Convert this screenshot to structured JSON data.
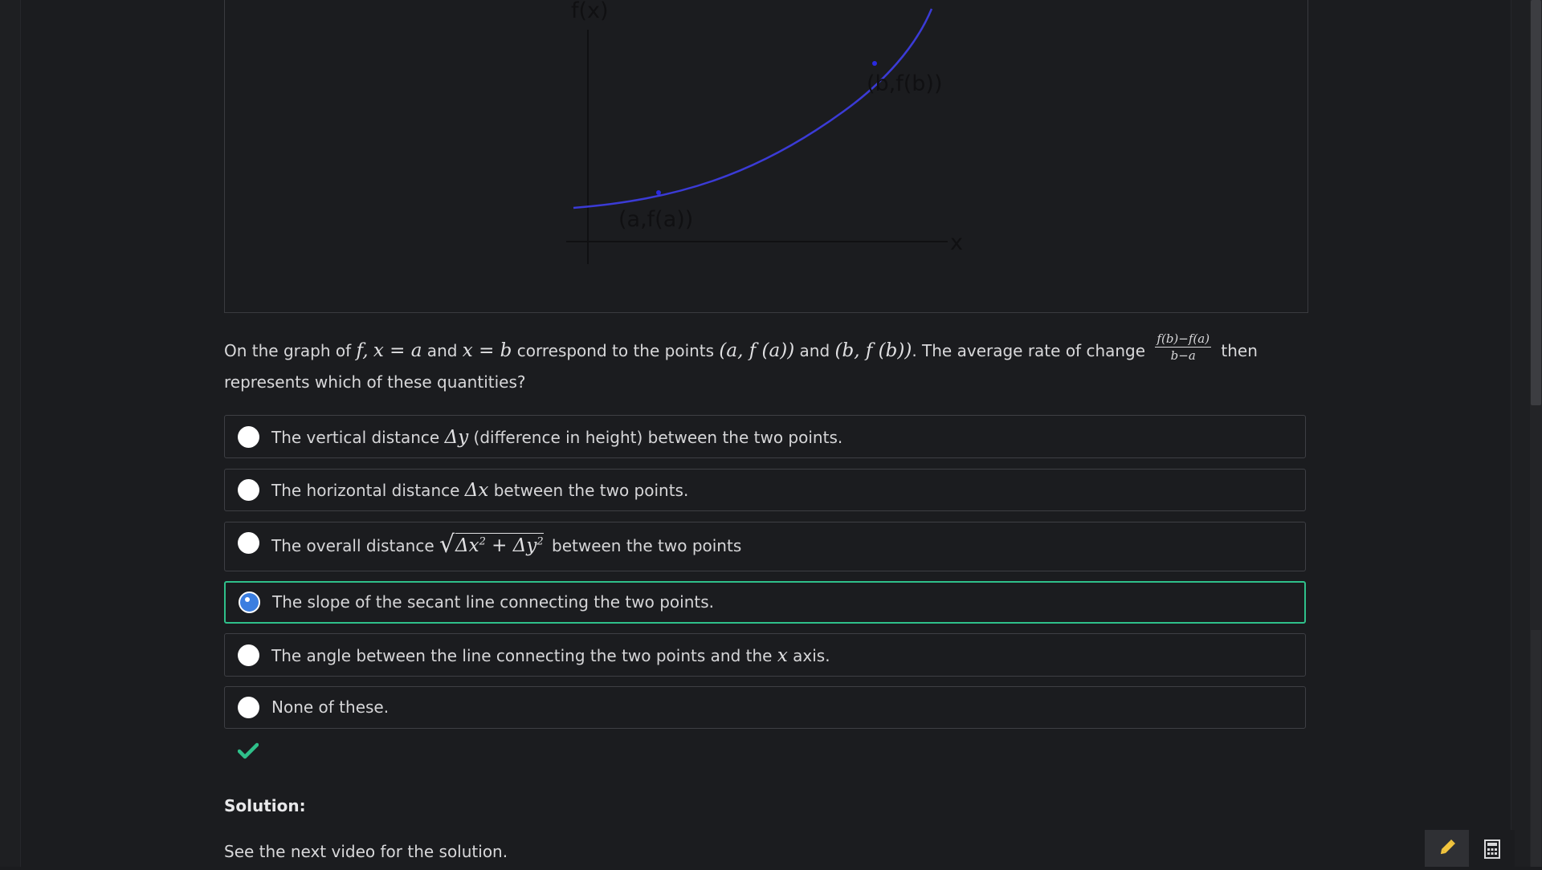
{
  "graph": {
    "y_label": "f(x)",
    "x_label": "x",
    "point_a_label": "(a,f(a))",
    "point_b_label": "(b,f(b))",
    "curve_color": "#3b3bd6",
    "axis_color": "#101012"
  },
  "question": {
    "part1": "On the graph of ",
    "math_f": "f",
    "comma": ",",
    "math_xa": "x = a",
    "and1": " and ",
    "math_xb": "x = b",
    "part2": " correspond to the points ",
    "math_pa": "(a, f (a))",
    "and2": " and ",
    "math_pb": "(b, f (b))",
    "part3": ". The average rate of change ",
    "frac_num": "f(b)−f(a)",
    "frac_den": "b−a",
    "part4": " then represents which of these quantities?"
  },
  "options": [
    {
      "pre": "The vertical distance ",
      "math": "Δy",
      "post": " (difference in height) between the two points."
    },
    {
      "pre": "The horizontal distance ",
      "math": "Δx",
      "post": " between the two points."
    },
    {
      "pre": "The overall distance ",
      "math_a": "Δx",
      "math_b": " + Δy",
      "sup": "2",
      "post": " between the two points"
    },
    {
      "text": "The slope of the secant line connecting the two points."
    },
    {
      "pre": "The angle between the line connecting the two points and the ",
      "math": "x",
      "post": " axis."
    },
    {
      "text": "None of these."
    }
  ],
  "selected_option": 4,
  "result_icon": "checkmark-icon",
  "accent_color": "#2fc08a",
  "solution": {
    "title": "Solution:",
    "text": "See the next video for the solution."
  },
  "tools": [
    "pencil-icon",
    "calculator-icon"
  ]
}
